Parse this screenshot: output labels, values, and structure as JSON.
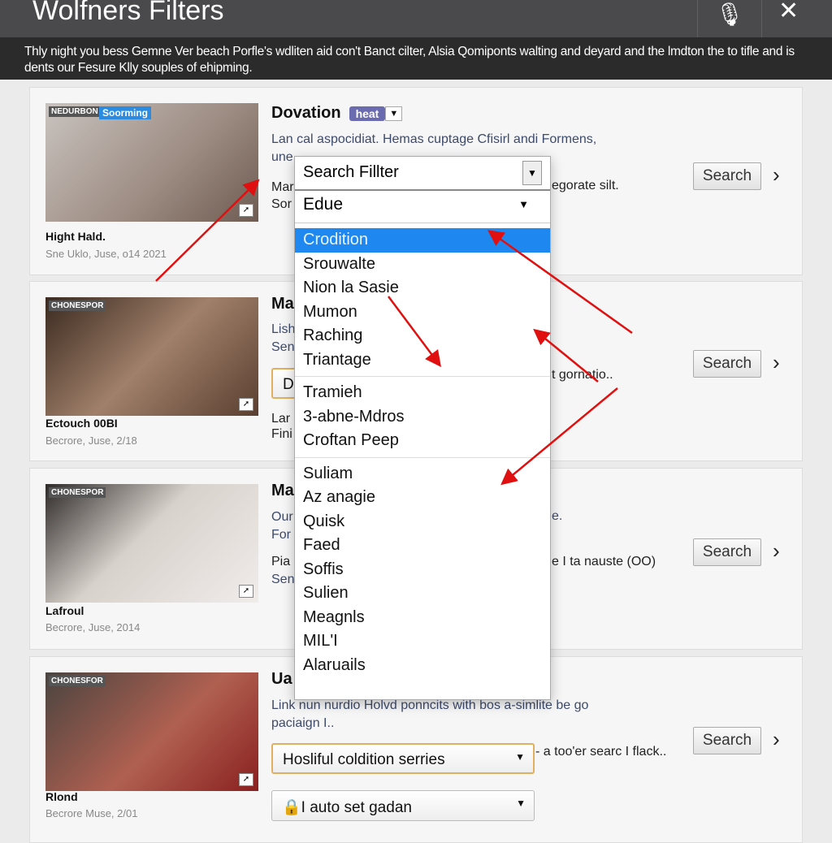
{
  "window": {
    "title": "Wolfners Filters",
    "mic_icon": "microphone-icon",
    "close_icon": "close-icon"
  },
  "banner": {
    "text": "Thly night you bess Gemne Ver beach Porfle's wdliten aid con't Banct cilter, Alsia Qomiponts walting and deyard and the lmdton the to tifle and is dents our Fesure Klly souples of ehipming."
  },
  "accent": "#1e88f0",
  "cards": [
    {
      "thumb_label": "NEDURBON",
      "thumb_badge": "Soorming",
      "name": "Hight Hald.",
      "date": "Sne Uklo, Juse, o14 2021",
      "title": "Dovation",
      "badge": "heat",
      "desc1": "Lan cal aspocidiat. Hemas cuptage Cfisirl andi Formens,",
      "desc2": "une",
      "desc3": "Mar",
      "desc3_right": "egorate silt.",
      "desc4": "Sor",
      "search": "Search"
    },
    {
      "thumb_label": "CHONESPOR",
      "name": "Ectouch 00BI",
      "date": "Becrore, Juse, 2/18",
      "title": "Ma",
      "desc1": "Lish",
      "desc2": "Sen",
      "input": "D",
      "right": "t gornatio..",
      "desc3": "Lar",
      "desc4": "Fini",
      "search": "Search"
    },
    {
      "thumb_label": "CHONESPOR",
      "name": "Lafroul",
      "date": "Becrore, Juse, 2014",
      "title": "Ma",
      "desc1": "Our",
      "desc1_right": "e.",
      "desc2": "For",
      "desc3": "Pia",
      "desc3_right": "e I ta nauste (OO)",
      "desc4": "Sen",
      "search": "Search"
    },
    {
      "thumb_label": "CHONESFOR",
      "name": "Rlond",
      "date": "Becrore Muse, 2/01",
      "title": "Ua",
      "desc1": "Link nun nurdio Holvd ponncits with bos a-simlite be go",
      "desc2": "paciaign I..",
      "select1": "Hosliful coldition serries",
      "select1_right": "- a too'er searc I flack..",
      "select2": "I auto set gadan",
      "search": "Search"
    }
  ],
  "dropdown": {
    "header": "Search Fillter",
    "value": "Edue",
    "selected": "Crodition",
    "groups": [
      [
        "Crodition",
        "Srouwalte",
        "Nion la Sasie",
        "Mumon",
        "Raching",
        "Triantage"
      ],
      [
        "Tramieh",
        "3-abne-Mdros",
        "Croftan Peep"
      ],
      [
        "Suliam",
        "Az anagie",
        "Quisk",
        "Faed",
        "Soffis",
        "Sulien",
        "Meagnls",
        "MIL'I",
        "Alaruails"
      ]
    ]
  }
}
